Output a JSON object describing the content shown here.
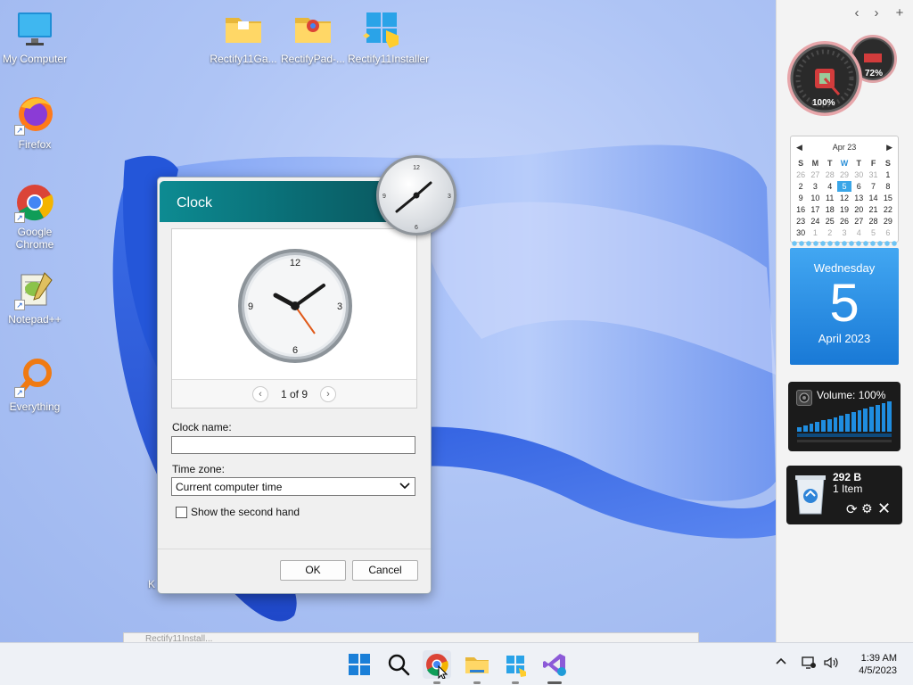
{
  "desktop": {
    "icons": [
      {
        "label": "My Computer",
        "icon": "computer-icon"
      },
      {
        "label": "Firefox",
        "icon": "firefox-icon"
      },
      {
        "label": "Google Chrome",
        "icon": "chrome-icon"
      },
      {
        "label": "Notepad++",
        "icon": "notepadpp-icon"
      },
      {
        "label": "Everything",
        "icon": "everything-search-icon"
      },
      {
        "label": "Rectify11Ga...",
        "icon": "folder-icon"
      },
      {
        "label": "RectifyPad-...",
        "icon": "folder-chrome-icon"
      },
      {
        "label": "Rectify11Installer",
        "icon": "installer-icon"
      }
    ],
    "hidden_label_fragment": "K",
    "background_window_title": "Rectify11Install..."
  },
  "sidebar": {
    "controls": {
      "prev": "‹",
      "next": "›",
      "add": "+"
    },
    "meter": {
      "cpu": "100%",
      "ram": "72%"
    },
    "calendar": {
      "month_label": "Apr 23",
      "weekday_headers": [
        "S",
        "M",
        "T",
        "W",
        "T",
        "F",
        "S"
      ],
      "weeks": [
        [
          "26",
          "27",
          "28",
          "29",
          "30",
          "31",
          "1"
        ],
        [
          "2",
          "3",
          "4",
          "5",
          "6",
          "7",
          "8"
        ],
        [
          "9",
          "10",
          "11",
          "12",
          "13",
          "14",
          "15"
        ],
        [
          "16",
          "17",
          "18",
          "19",
          "20",
          "21",
          "22"
        ],
        [
          "23",
          "24",
          "25",
          "26",
          "27",
          "28",
          "29"
        ],
        [
          "30",
          "1",
          "2",
          "3",
          "4",
          "5",
          "6"
        ]
      ],
      "today": "5"
    },
    "day_card": {
      "weekday": "Wednesday",
      "day": "5",
      "month_year": "April 2023"
    },
    "volume": {
      "label": "Volume: 100%",
      "level": 1.0
    },
    "recycle_bin": {
      "size": "292 B",
      "items": "1 Item"
    }
  },
  "clock_dialog": {
    "title": "Clock",
    "clock_numbers": [
      "12",
      "3",
      "6",
      "9"
    ],
    "pager": {
      "prev": "‹",
      "text": "1 of 9",
      "next": "›"
    },
    "clock_name_label": "Clock name:",
    "clock_name_value": "",
    "time_zone_label": "Time zone:",
    "time_zone_value": "Current computer time",
    "second_hand_label": "Show the second hand",
    "second_hand_checked": false,
    "ok_label": "OK",
    "cancel_label": "Cancel"
  },
  "floating_clock": {
    "numbers": [
      "12",
      "3",
      "6",
      "9"
    ]
  },
  "taskbar": {
    "apps": [
      "start-icon",
      "search-icon",
      "chrome-icon",
      "file-explorer-icon",
      "rectify-installer-icon",
      "visual-studio-icon"
    ],
    "tray": {
      "time": "1:39 AM",
      "date": "4/5/2023"
    }
  },
  "colors": {
    "accent": "#0a7c84",
    "calendar_today": "#3aa6e8",
    "day_card": "#1f8ae0",
    "volume_bar": "#1f8de0"
  }
}
